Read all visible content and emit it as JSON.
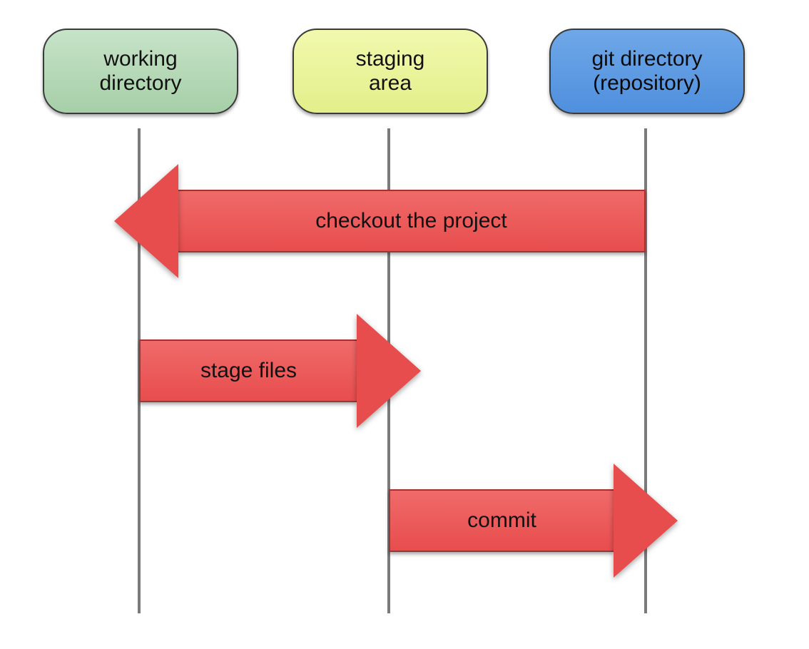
{
  "stages": {
    "working": {
      "label": "working\ndirectory"
    },
    "staging": {
      "label": "staging\narea"
    },
    "repo": {
      "label": "git directory\n(repository)"
    }
  },
  "arrows": {
    "checkout": {
      "label": "checkout the project"
    },
    "stage": {
      "label": "stage files"
    },
    "commit": {
      "label": "commit"
    }
  },
  "colors": {
    "stage_working": "#b6d9b7",
    "stage_staging": "#eaf39c",
    "stage_repo": "#5f9ce3",
    "arrow": "#e84d4d",
    "lifeline": "#7a7a7a"
  }
}
